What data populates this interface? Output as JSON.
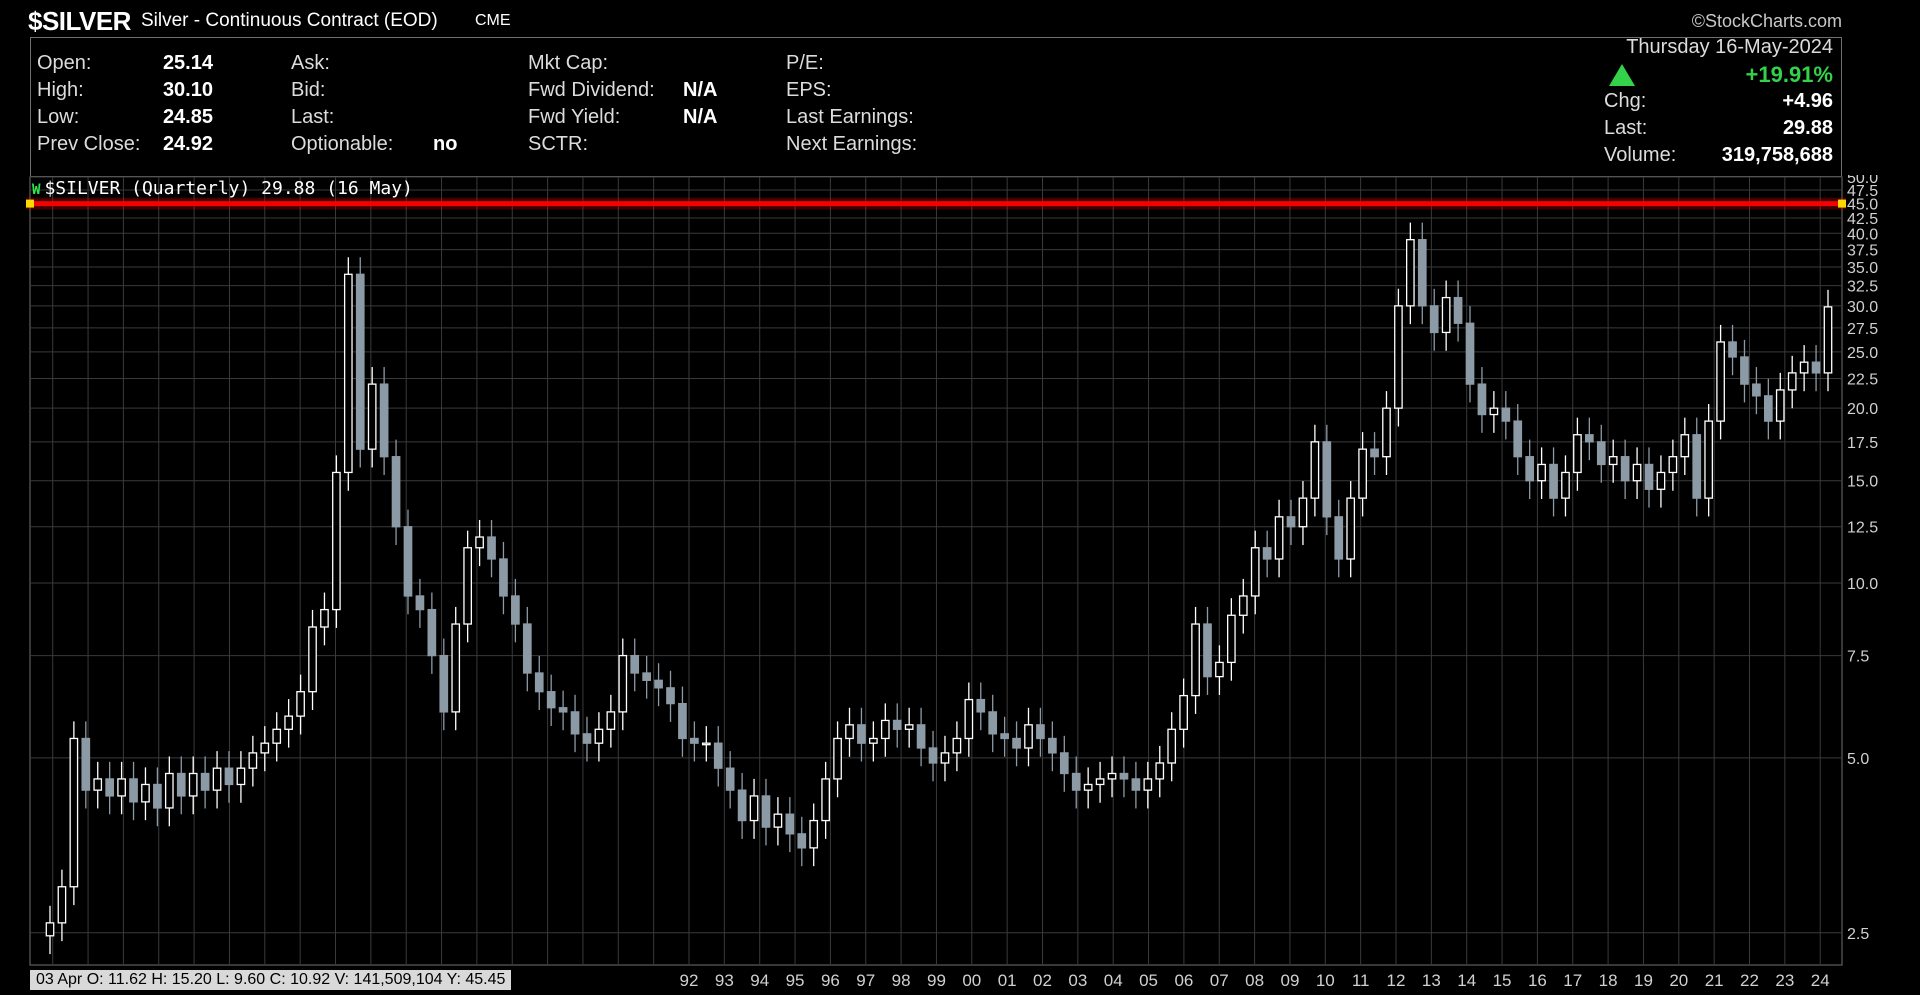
{
  "header": {
    "symbol": "$SILVER",
    "description": "Silver - Continuous Contract (EOD)",
    "exchange": "CME",
    "brand": "©StockCharts.com"
  },
  "quote": {
    "open_label": "Open:",
    "open": "25.14",
    "high_label": "High:",
    "high": "30.10",
    "low_label": "Low:",
    "low": "24.85",
    "prev_close_label": "Prev Close:",
    "prev_close": "24.92",
    "ask_label": "Ask:",
    "bid_label": "Bid:",
    "last_label_mid": "Last:",
    "optionable_label": "Optionable:",
    "optionable": "no",
    "mkt_cap_label": "Mkt Cap:",
    "fwd_dividend_label": "Fwd Dividend:",
    "fwd_dividend": "N/A",
    "fwd_yield_label": "Fwd Yield:",
    "fwd_yield": "N/A",
    "sctr_label": "SCTR:",
    "pe_label": "P/E:",
    "eps_label": "EPS:",
    "last_earnings_label": "Last Earnings:",
    "next_earnings_label": "Next Earnings:",
    "date": "Thursday 16-May-2024",
    "change_pct": "+19.91%",
    "chg_label": "Chg:",
    "chg": "+4.96",
    "last_label": "Last:",
    "last": "29.88",
    "volume_label": "Volume:",
    "volume": "319,758,688",
    "up_color": "#34d14a"
  },
  "panel": {
    "label": "$SILVER (Quarterly) 29.88 (16 May)",
    "icon": "price-icon"
  },
  "summary": "03 Apr O: 11.62   H: 15.20   L: 9.60   C: 10.92   V: 141,509,104   Y: 45.45",
  "chart_data": {
    "type": "candlestick",
    "period": "Quarterly",
    "y_scale": "log",
    "ylim": [
      2.2,
      50
    ],
    "y_ticks": [
      "2.5",
      "5.0",
      "7.5",
      "10.0",
      "12.5",
      "15.0",
      "17.5",
      "20.0",
      "22.5",
      "25.0",
      "27.5",
      "30.0",
      "32.5",
      "35.0",
      "37.5",
      "40.0",
      "42.5",
      "45.0",
      "47.5",
      "50.0"
    ],
    "x_tick_labels": [
      "92",
      "93",
      "94",
      "95",
      "96",
      "97",
      "98",
      "99",
      "00",
      "01",
      "02",
      "03",
      "04",
      "05",
      "06",
      "07",
      "08",
      "09",
      "10",
      "11",
      "12",
      "13",
      "14",
      "15",
      "16",
      "17",
      "18",
      "19",
      "20",
      "21",
      "22",
      "23",
      "24"
    ],
    "horizontal_line": {
      "value": 45,
      "color": "#ff0000"
    },
    "colors": {
      "up": "#ffffff",
      "down": "#8c9aa6",
      "grid": "#3a3a3a",
      "axis_text": "#d0d0d0"
    },
    "closes": [
      2.6,
      3.0,
      5.4,
      4.4,
      4.6,
      4.3,
      4.6,
      4.2,
      4.5,
      4.1,
      4.7,
      4.3,
      4.7,
      4.4,
      4.8,
      4.5,
      4.8,
      5.1,
      5.3,
      5.6,
      5.9,
      6.5,
      8.4,
      9.0,
      15.5,
      34.0,
      17.0,
      22.0,
      16.5,
      12.5,
      9.5,
      9.0,
      7.5,
      6.0,
      8.5,
      11.5,
      12.0,
      11.0,
      9.5,
      8.5,
      7.0,
      6.5,
      6.1,
      6.0,
      5.5,
      5.3,
      5.6,
      6.0,
      7.5,
      7.0,
      6.8,
      6.6,
      6.2,
      5.4,
      5.3,
      5.3,
      4.8,
      4.4,
      3.9,
      4.3,
      3.8,
      4.0,
      3.7,
      3.5,
      3.9,
      4.6,
      5.4,
      5.7,
      5.3,
      5.4,
      5.8,
      5.6,
      5.7,
      5.2,
      4.9,
      5.1,
      5.4,
      6.3,
      6.0,
      5.5,
      5.4,
      5.2,
      5.7,
      5.4,
      5.1,
      4.7,
      4.4,
      4.5,
      4.6,
      4.7,
      4.6,
      4.4,
      4.6,
      4.9,
      5.6,
      6.4,
      8.5,
      6.9,
      7.3,
      8.8,
      9.5,
      11.5,
      11.0,
      13.0,
      12.5,
      14.0,
      17.5,
      13.0,
      11.0,
      14.0,
      17.0,
      16.5,
      20.0,
      30.0,
      39.0,
      30.0,
      27.0,
      31.0,
      28.0,
      22.0,
      19.5,
      20.0,
      19.0,
      16.5,
      15.0,
      16.0,
      14.0,
      15.5,
      18.0,
      17.5,
      16.0,
      16.5,
      15.0,
      16.0,
      14.5,
      15.5,
      16.5,
      18.0,
      14.0,
      19.0,
      26.0,
      24.5,
      22.0,
      21.0,
      19.0,
      21.5,
      23.0,
      24.0,
      23.0,
      29.88
    ]
  }
}
